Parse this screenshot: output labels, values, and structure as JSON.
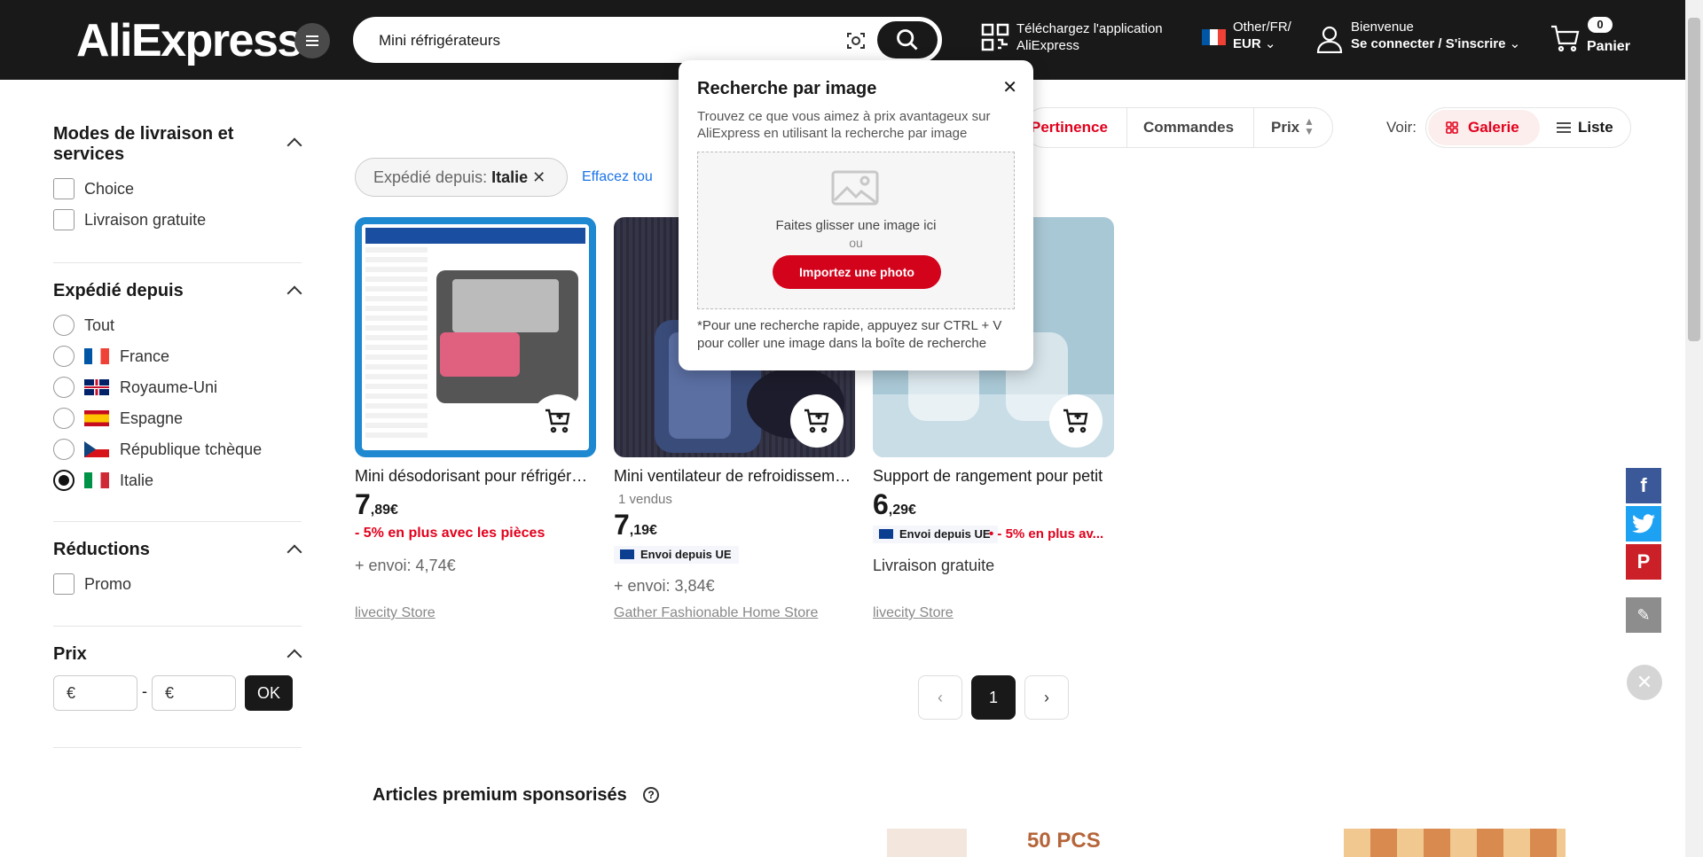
{
  "header": {
    "logo": "AliExpress",
    "search_value": "Mini réfrigérateurs",
    "app_line1": "Téléchargez l'application",
    "app_line2": "AliExpress",
    "locale_line1": "Other/FR/",
    "locale_line2": "EUR",
    "account_line1": "Bienvenue",
    "account_line2": "Se connecter / S'inscrire",
    "cart_count": "0",
    "cart_label": "Panier"
  },
  "image_search": {
    "title": "Recherche par image",
    "desc": "Trouvez ce que vous aimez à prix avantageux sur AliExpress en utilisant la recherche par image",
    "drag": "Faites glisser une image ici",
    "or": "ou",
    "upload": "Importez une photo",
    "note": "*Pour une recherche rapide, appuyez sur CTRL + V pour coller une image dans la boîte de recherche"
  },
  "sidebar": {
    "delivery_title": "Modes de livraison et services",
    "delivery_options": [
      "Choice",
      "Livraison gratuite"
    ],
    "from_title": "Expédié depuis",
    "from_options": [
      "Tout",
      "France",
      "Royaume-Uni",
      "Espagne",
      "République tchèque",
      "Italie"
    ],
    "from_selected": "Italie",
    "discount_title": "Réductions",
    "discount_options": [
      "Promo"
    ],
    "price_title": "Prix",
    "price_min": "€",
    "price_max": "€",
    "price_sep": "-",
    "ok": "OK"
  },
  "sort": {
    "options": [
      "Pertinence",
      "Commandes",
      "Prix"
    ],
    "active": "Pertinence",
    "view_label": "Voir:",
    "views": [
      "Galerie",
      "Liste"
    ]
  },
  "filter_chip": {
    "label": "Expédié depuis:",
    "value": "Italie",
    "clear": "Effacez tou"
  },
  "products": [
    {
      "title": "Mini désodorisant pour réfrigérateur",
      "price_int": "7",
      "price_dec": ",89€",
      "promo": "- 5% en plus avec les pièces",
      "shipping": "+ envoi: 4,74€",
      "store": "livecity Store"
    },
    {
      "title": "Mini ventilateur de refroidissement",
      "sold": "1 vendus",
      "price_int": "7",
      "price_dec": ",19€",
      "badge": "Envoi depuis UE",
      "shipping": "+ envoi: 3,84€",
      "store": "Gather Fashionable Home Store"
    },
    {
      "title": "Support de rangement pour petit",
      "price_int": "6",
      "price_dec": ",29€",
      "badge": "Envoi depuis UE",
      "promo": "• - 5% en plus av...",
      "shipping": "Livraison gratuite",
      "store": "livecity Store"
    }
  ],
  "pagination": {
    "prev": "‹",
    "current": "1",
    "next": "›"
  },
  "sponsored": {
    "title": "Articles premium sponsorisés",
    "tag": "50 PCS"
  },
  "colors": {
    "accent": "#e2011d",
    "dark": "#191919",
    "upload": "#d3031c"
  }
}
